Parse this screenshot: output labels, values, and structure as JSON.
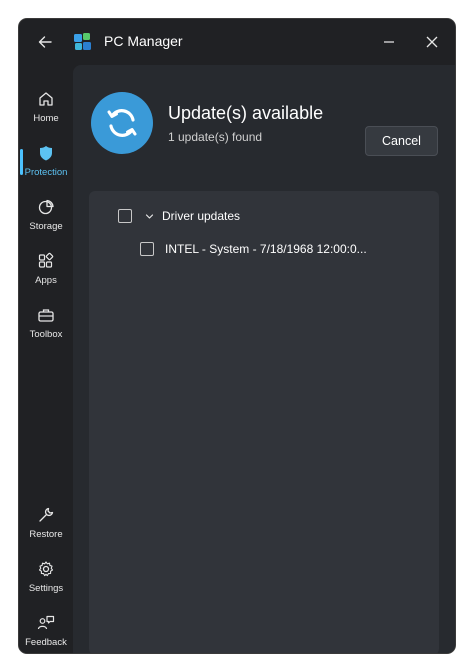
{
  "titlebar": {
    "app_title": "PC Manager",
    "back_icon": "back-arrow-icon",
    "minimize_icon": "minimize-icon",
    "close_icon": "close-icon"
  },
  "sidebar": {
    "items": [
      {
        "label": "Home",
        "icon": "home-icon",
        "active": false
      },
      {
        "label": "Protection",
        "icon": "shield-icon",
        "active": true
      },
      {
        "label": "Storage",
        "icon": "pie-chart-icon",
        "active": false
      },
      {
        "label": "Apps",
        "icon": "apps-grid-icon",
        "active": false
      },
      {
        "label": "Toolbox",
        "icon": "toolbox-icon",
        "active": false
      }
    ],
    "bottom_items": [
      {
        "label": "Restore",
        "icon": "wrench-icon"
      },
      {
        "label": "Settings",
        "icon": "gear-icon"
      },
      {
        "label": "Feedback",
        "icon": "feedback-icon"
      }
    ]
  },
  "header": {
    "title": "Update(s) available",
    "subtitle": "1 update(s) found",
    "cancel_label": "Cancel",
    "icon": "sync-icon"
  },
  "updates": {
    "group_label": "Driver updates",
    "items": [
      {
        "label": "INTEL - System - 7/18/1968 12:00:0..."
      }
    ]
  },
  "colors": {
    "accent": "#4cc2ff",
    "window_bg": "#202124",
    "content_bg": "#272a2f",
    "panel_bg": "#31343a",
    "hero_icon_bg": "#3a9ad8"
  }
}
